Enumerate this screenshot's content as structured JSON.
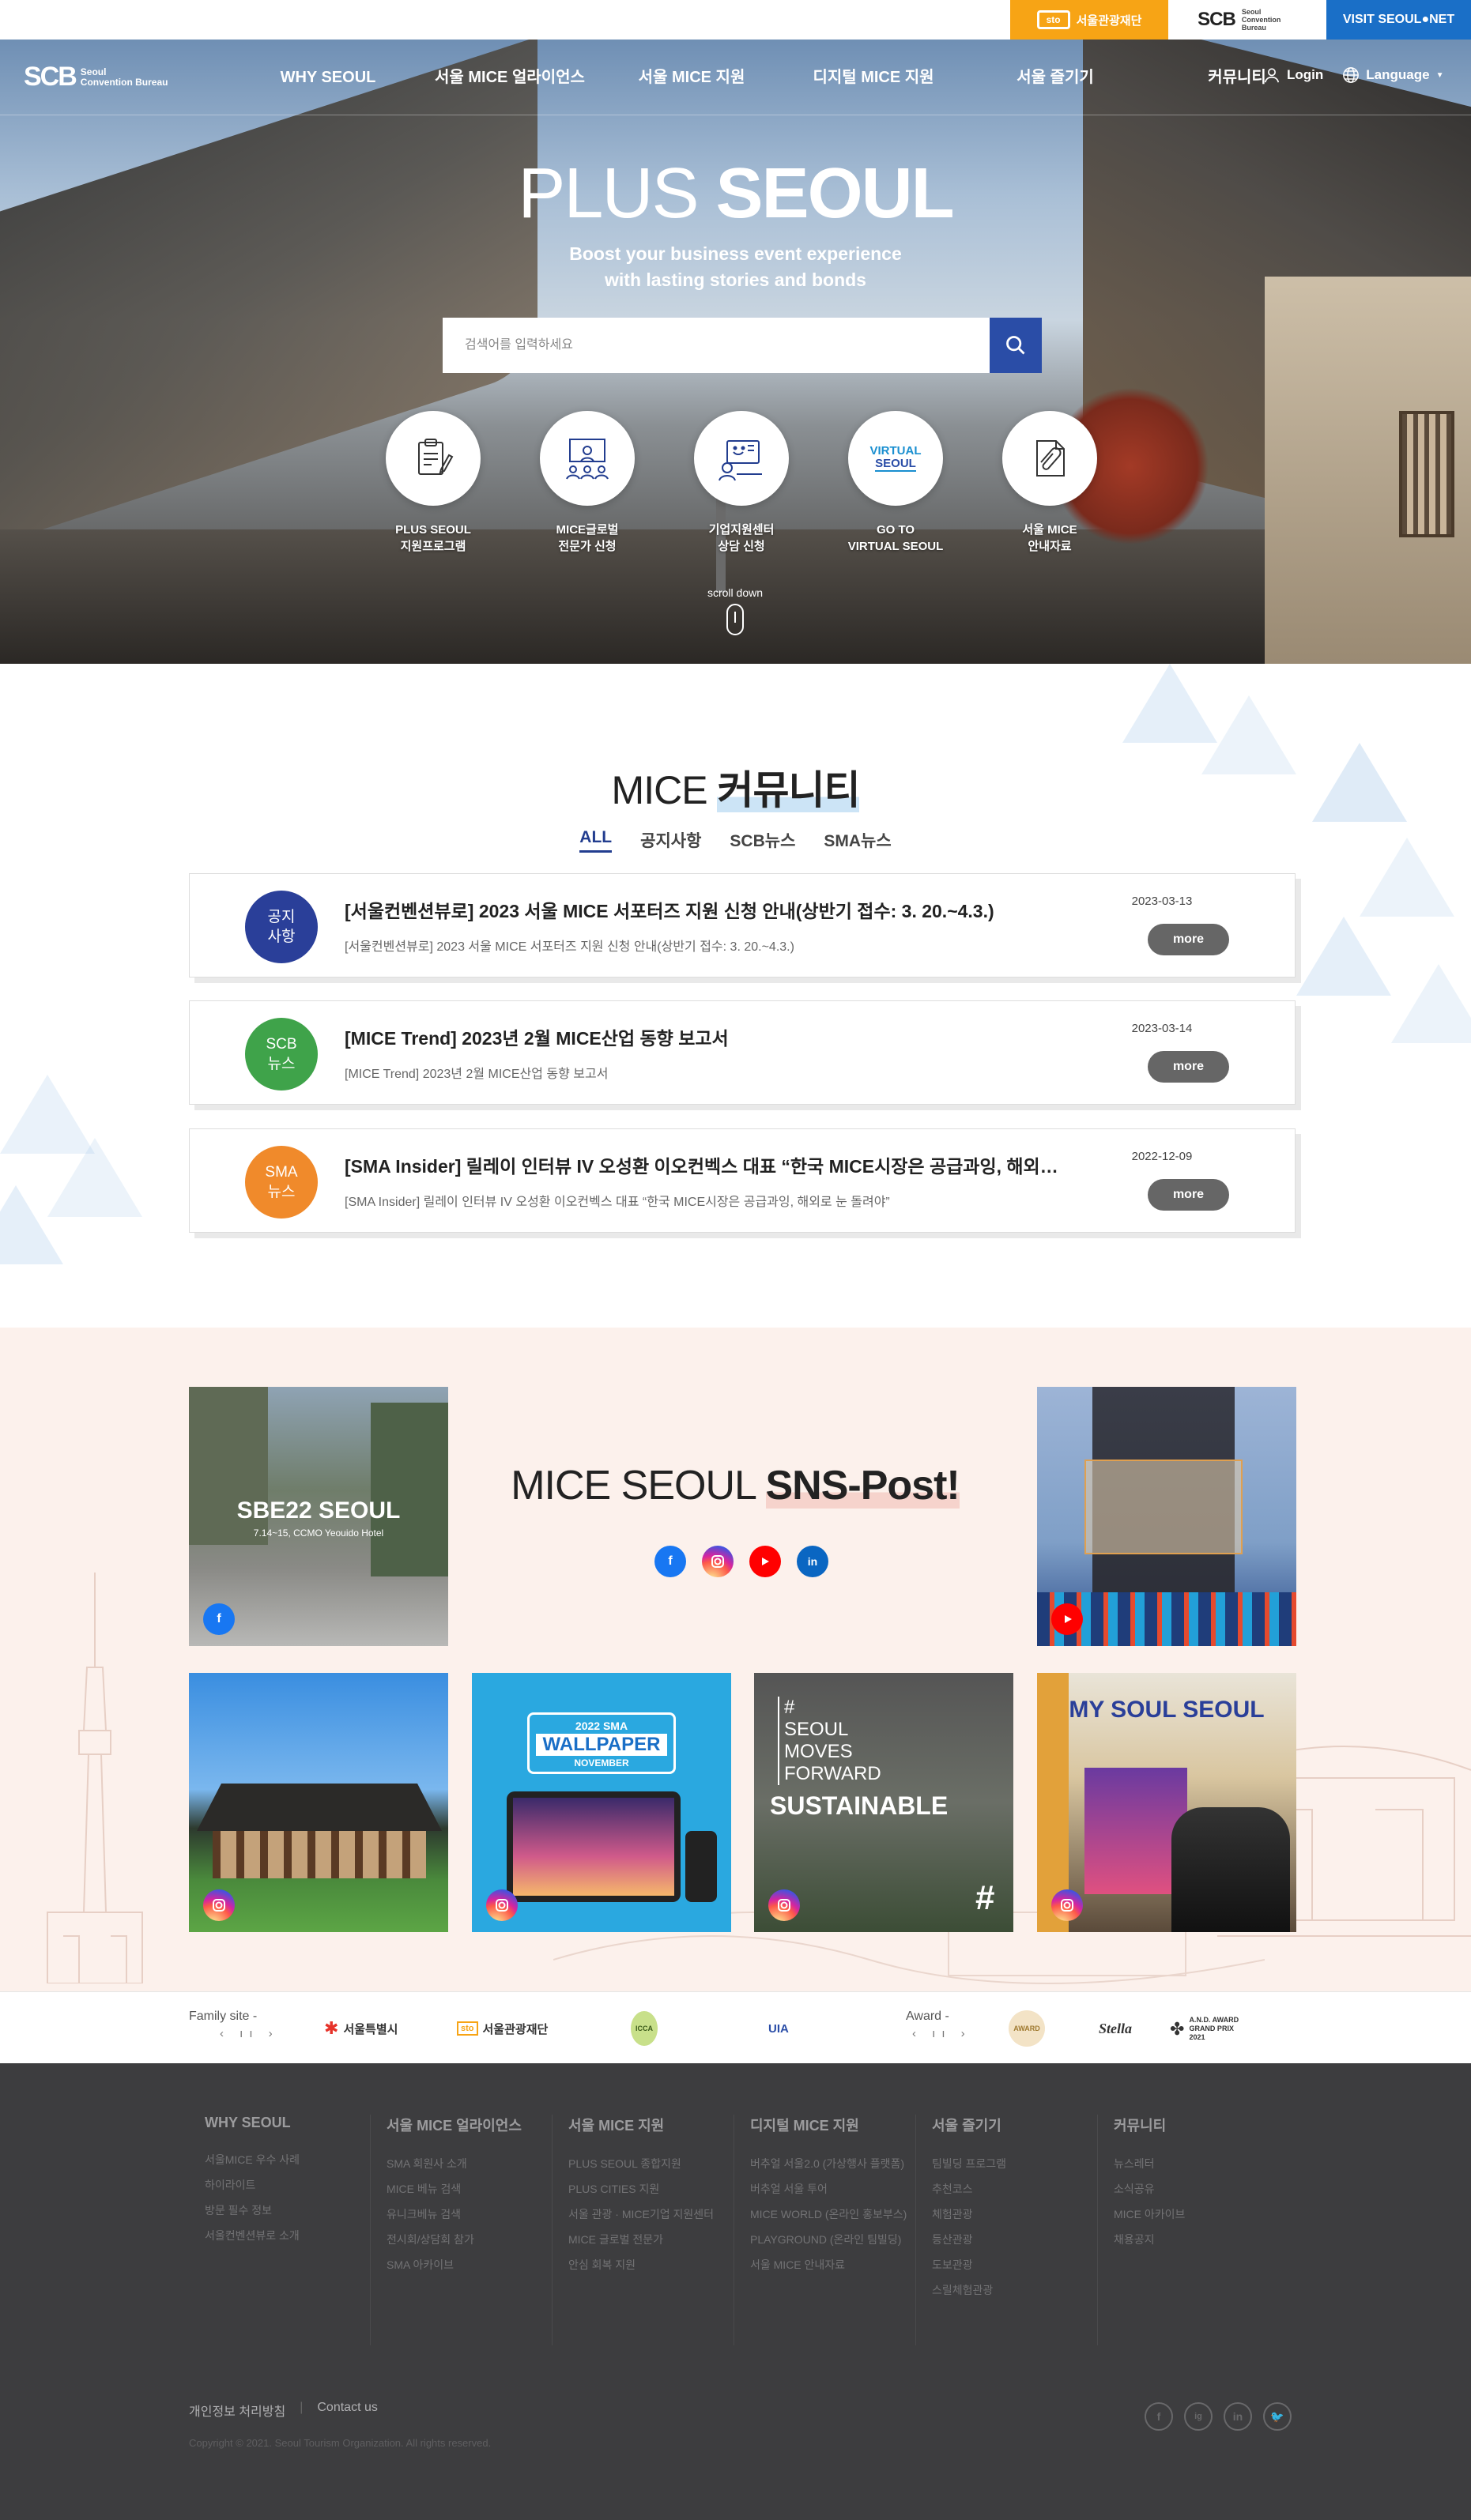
{
  "topbar": {
    "sto_logo": "sto",
    "sto_label": "서울관광재단",
    "scb_logo": "SCB",
    "scb_sub": "Seoul Convention Bureau",
    "visit_label": "VISIT SEOUL●NET"
  },
  "nav": {
    "logo": "SCB",
    "logo_sub_1": "Seoul",
    "logo_sub_2": "Convention Bureau",
    "menu": [
      "WHY SEOUL",
      "서울 MICE 얼라이언스",
      "서울 MICE 지원",
      "디지털 MICE 지원",
      "서울 즐기기",
      "커뮤니티"
    ],
    "login": "Login",
    "language": "Language"
  },
  "hero": {
    "title_light": "PLUS",
    "title_bold": "SEOUL",
    "subtitle_1": "Boost your business event experience",
    "subtitle_2": "with lasting stories and bonds",
    "search_placeholder": "검색어를 입력하세요",
    "quick": [
      {
        "l1": "PLUS SEOUL",
        "l2": "지원프로그램",
        "icon": "clipboard-icon"
      },
      {
        "l1": "MICE글로벌",
        "l2": "전문가 신청",
        "icon": "presenter-icon"
      },
      {
        "l1": "기업지원센터",
        "l2": "상담 신청",
        "icon": "consult-icon"
      },
      {
        "l1": "GO TO",
        "l2": "VIRTUAL SEOUL",
        "icon": "virtual-seoul-logo"
      },
      {
        "l1": "서울 MICE",
        "l2": "안내자료",
        "icon": "attachment-icon"
      }
    ],
    "virtual_logo_1": "VIRTUAL",
    "virtual_logo_2": "SEOUL",
    "scroll_label": "scroll down"
  },
  "community": {
    "title_light": "MICE",
    "title_bold": "커뮤니티",
    "tabs": [
      "ALL",
      "공지사항",
      "SCB뉴스",
      "SMA뉴스"
    ],
    "posts": [
      {
        "badge_1": "공지",
        "badge_2": "사항",
        "color": "#2a3f99",
        "title": "[서울컨벤션뷰로] 2023 서울 MICE 서포터즈 지원 신청 안내(상반기 접수: 3. 20.~4.3.)",
        "desc": "[서울컨벤션뷰로] 2023 서울 MICE 서포터즈 지원 신청 안내(상반기 접수: 3. 20.~4.3.)",
        "date": "2023-03-13",
        "more": "more"
      },
      {
        "badge_1": "SCB",
        "badge_2": "뉴스",
        "color": "#3fa34a",
        "title": "[MICE Trend] 2023년 2월 MICE산업 동향 보고서",
        "desc": "[MICE Trend] 2023년 2월 MICE산업 동향 보고서",
        "date": "2023-03-14",
        "more": "more"
      },
      {
        "badge_1": "SMA",
        "badge_2": "뉴스",
        "color": "#f08a2b",
        "title": "[SMA Insider] 릴레이 인터뷰 IV 오성환 이오컨벡스 대표 “한국 MICE시장은 공급과잉, 해외로 눈 돌려야”",
        "desc": "[SMA Insider] 릴레이 인터뷰 IV 오성환 이오컨벡스 대표 “한국 MICE시장은 공급과잉, 해외로 눈 돌려야”",
        "date": "2022-12-09",
        "more": "more"
      }
    ]
  },
  "sns": {
    "title_light": "MICE SEOUL",
    "title_bold": "SNS-Post!",
    "icons": [
      "facebook-icon",
      "instagram-icon",
      "youtube-icon",
      "linkedin-icon"
    ],
    "tile1_title": "SBE22 SEOUL",
    "tile1_sub": "7.14~15, CCMO Yeouido Hotel",
    "tile4_1": "2022 SMA",
    "tile4_2": "WALLPAPER",
    "tile4_3": "NOVEMBER",
    "tile5_1": "#",
    "tile5_2": "SEOUL",
    "tile5_3": "MOVES",
    "tile5_4": "FORWARD",
    "tile5_5": "SUSTAINABLE",
    "tile5_hash": "#",
    "tile6_1": "MY SOUL SEOUL"
  },
  "family": {
    "family_label": "Family site -",
    "award_label": "Award -",
    "ctrl": "‹ ıı ›",
    "logos": [
      "서울특별시",
      "서울관광재단",
      "ICCA",
      "UIA"
    ],
    "award_logos": [
      "AWARD",
      "Stella",
      "A.N.D. AWARD GRAND PRIX 2021"
    ]
  },
  "footer": {
    "columns": [
      {
        "head": "WHY SEOUL",
        "items": [
          "서울MICE 우수 사례",
          "하이라이트",
          "방문 필수 정보",
          "서울컨벤션뷰로 소개"
        ]
      },
      {
        "head": "서울 MICE 얼라이언스",
        "items": [
          "SMA 회원사 소개",
          "MICE 베뉴 검색",
          "유니크베뉴 검색",
          "전시회/상담회 참가",
          "SMA 아카이브"
        ]
      },
      {
        "head": "서울 MICE 지원",
        "items": [
          "PLUS SEOUL 종합지원",
          "PLUS CITIES 지원",
          "서울 관광 · MICE기업 지원센터",
          "MICE 글로벌 전문가",
          "안심 회복 지원"
        ]
      },
      {
        "head": "디지털 MICE 지원",
        "items": [
          "버추얼 서울2.0 (가상행사 플랫폼)",
          "버추얼 서울 투어",
          "MICE WORLD (온라인 홍보부스)",
          "PLAYGROUND (온라인 팀빌딩)",
          "서울 MICE 안내자료"
        ]
      },
      {
        "head": "서울 즐기기",
        "items": [
          "팀빌딩 프로그램",
          "추천코스",
          "체험관광",
          "등산관광",
          "도보관광",
          "스릴체험관광"
        ]
      },
      {
        "head": "커뮤니티",
        "items": [
          "뉴스레터",
          "소식공유",
          "MICE 아카이브",
          "채용공지"
        ]
      }
    ],
    "privacy": "개인정보 처리방침",
    "sep": "|",
    "contact": "Contact us",
    "copyright": "Copyright © 2021. Seoul Tourism Organization. All rights reserved.",
    "sns": [
      "f",
      "ig",
      "in",
      "🐦"
    ]
  }
}
